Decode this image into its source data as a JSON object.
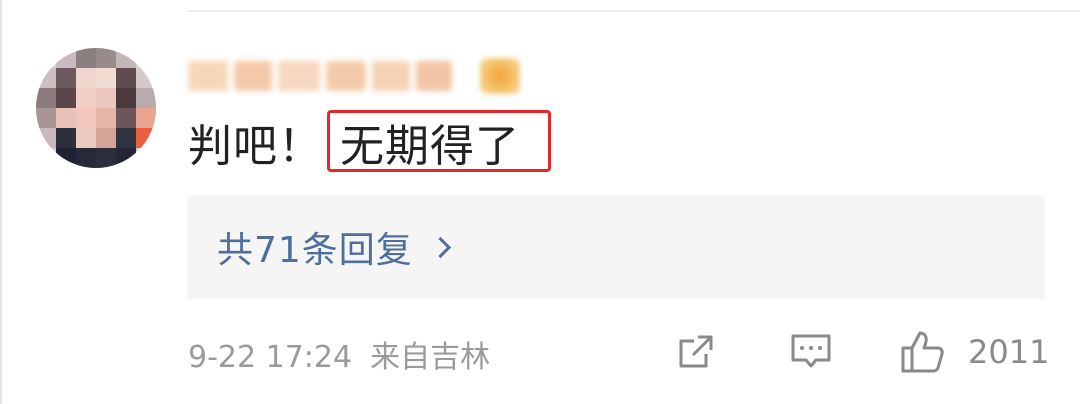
{
  "comment": {
    "text_prefix": "判吧！",
    "text_highlighted": "无期得了",
    "highlight_color": "#e4262b"
  },
  "replies": {
    "label": "共71条回复"
  },
  "footer": {
    "timestamp": "9-22 17:24",
    "location": "来自吉林",
    "like_count": "2011"
  },
  "icons": {
    "share": "share-icon",
    "comment": "comment-icon",
    "like": "thumbs-up-icon",
    "chevron": "chevron-right-icon"
  },
  "colors": {
    "link": "#4f6e9b",
    "meta": "#9b9b9b",
    "text": "#222222",
    "reply_bg": "#f5f5f5"
  }
}
